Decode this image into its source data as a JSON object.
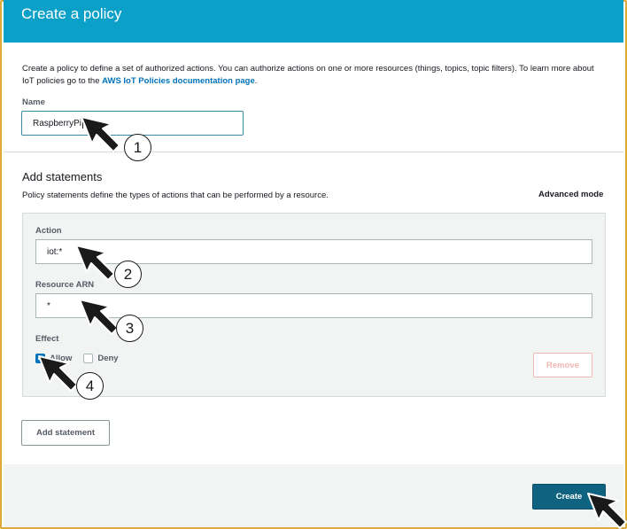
{
  "header": {
    "title": "Create a policy"
  },
  "intro": {
    "text": "Create a policy to define a set of authorized actions. You can authorize actions on one or more resources (things, topics, topic filters). To learn more about IoT policies go to the ",
    "link": "AWS IoT Policies documentation page",
    "suffix": "."
  },
  "name": {
    "label": "Name",
    "value": "RaspberryPi"
  },
  "statements": {
    "title": "Add statements",
    "description": "Policy statements define the types of actions that can be performed by a resource.",
    "advanced_mode": "Advanced mode",
    "action": {
      "label": "Action",
      "value": "iot:*"
    },
    "resource": {
      "label": "Resource ARN",
      "value": "*"
    },
    "effect": {
      "label": "Effect",
      "allow": "Allow",
      "deny": "Deny",
      "allow_checked": true,
      "deny_checked": false
    },
    "remove_label": "Remove",
    "add_label": "Add statement"
  },
  "footer": {
    "create_label": "Create"
  },
  "annotations": {
    "step1": "1",
    "step2": "2",
    "step3": "3",
    "step4": "4"
  },
  "colors": {
    "header": "#0aa0c8",
    "primary_button": "#0f6380",
    "link": "#0073bb",
    "remove_disabled": "#f1b7b2",
    "frame_border": "#e0a93a"
  }
}
